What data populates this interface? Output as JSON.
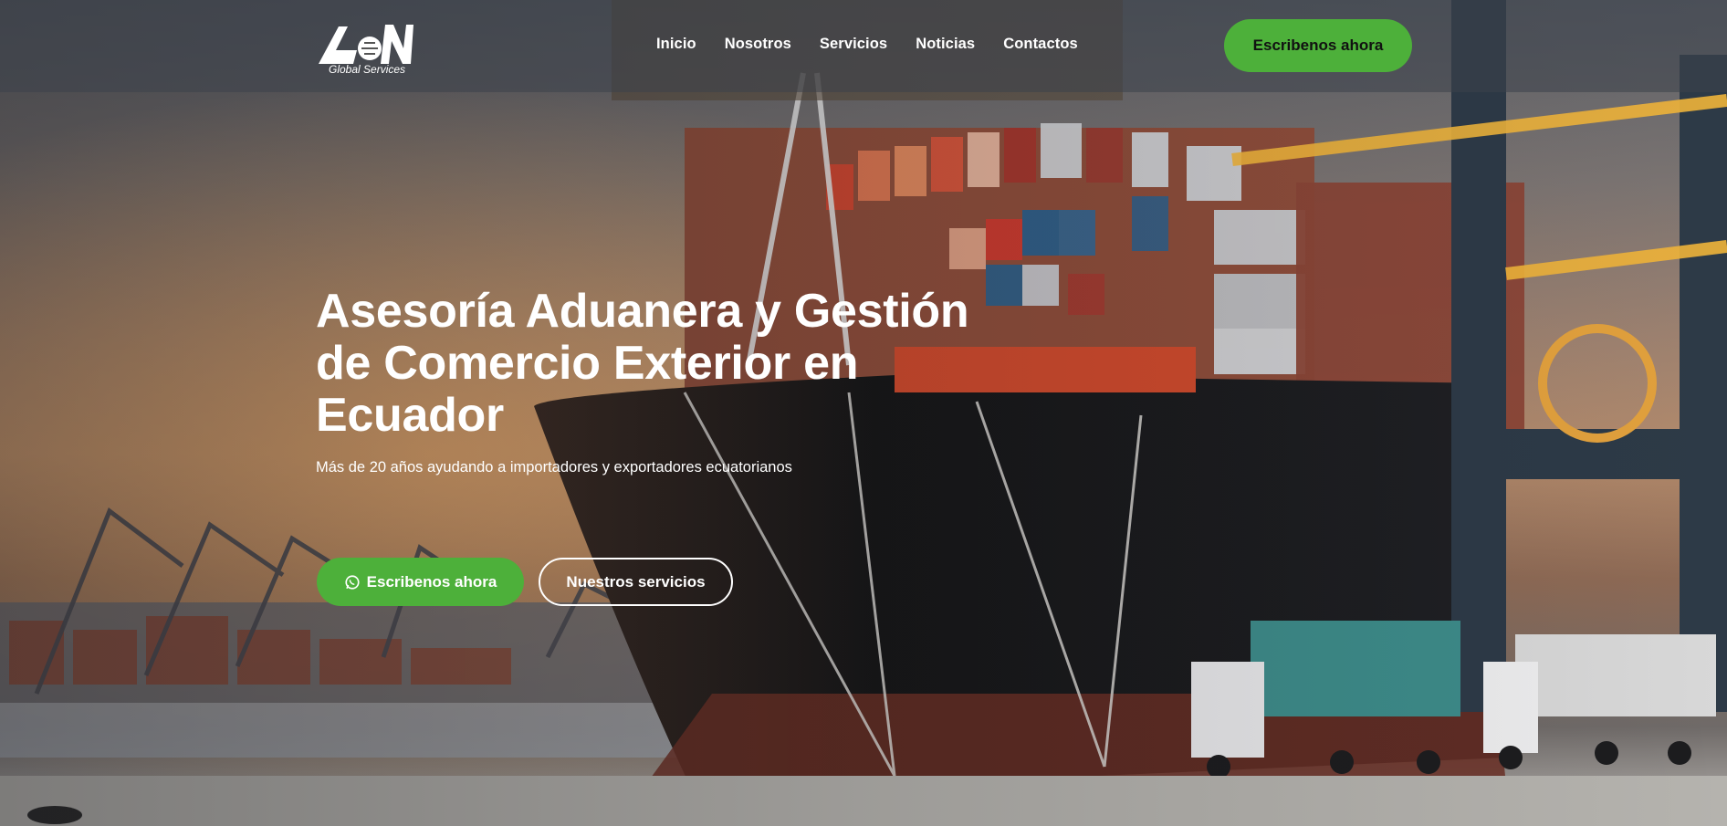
{
  "header": {
    "logo_text": "Global Services",
    "nav": [
      "Inicio",
      "Nosotros",
      "Servicios",
      "Noticias",
      "Contactos"
    ],
    "cta": "Escribenos ahora"
  },
  "hero": {
    "headline": "Asesoría Aduanera y Gestión de Comercio Exterior en Ecuador",
    "subheadline": "Más de 20 años ayudando a importadores y exportadores ecuatorianos",
    "primary_button": "Escribenos ahora",
    "primary_button_icon": "whatsapp-icon",
    "secondary_button": "Nuestros servicios"
  },
  "colors": {
    "accent_green": "#4db03a",
    "text": "#ffffff"
  }
}
